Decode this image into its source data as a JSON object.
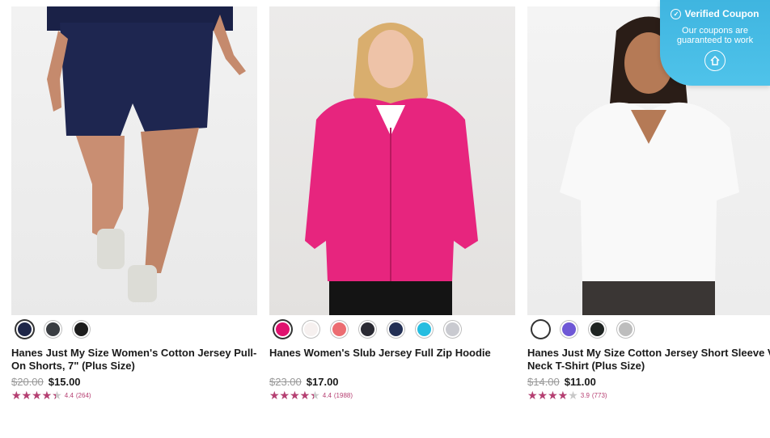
{
  "products": [
    {
      "title_line1": "Hanes Just My Size Women's Cotton Jersey Pull-",
      "title_line2": "On Shorts, 7\" (Plus Size)",
      "old_price": "$20.00",
      "new_price": "$15.00",
      "rating": "4.4",
      "reviews": "(264)",
      "rating_fraction": 0.88,
      "swatches": [
        "#1e2648",
        "#3a3d42",
        "#1d1d1d"
      ],
      "selected_swatch": 0
    },
    {
      "title_line1": "Hanes Women's Slub Jersey Full Zip Hoodie",
      "title_line2": "",
      "old_price": "$23.00",
      "new_price": "$17.00",
      "rating": "4.4",
      "reviews": "(1988)",
      "rating_fraction": 0.88,
      "swatches": [
        "#e0126f",
        "#f6f0ef",
        "#ec6d72",
        "#2a2a33",
        "#233055",
        "#25bde0",
        "#c9cad0"
      ],
      "selected_swatch": 0
    },
    {
      "title_line1": "Hanes Just My Size Cotton Jersey Short Sleeve V-",
      "title_line2": "Neck T-Shirt (Plus Size)",
      "old_price": "$14.00",
      "new_price": "$11.00",
      "rating": "3.9",
      "reviews": "(773)",
      "rating_fraction": 0.78,
      "swatches": [
        "#ffffff",
        "#6f58d6",
        "#1f2422",
        "#bdbdbd"
      ],
      "selected_swatch": 0
    }
  ],
  "coupon": {
    "title": "Verified Coupon",
    "line1": "Our coupons are",
    "line2": "guaranteed to work"
  },
  "colors": {
    "accent": "#b63f72",
    "coupon": "#44bbe4"
  }
}
